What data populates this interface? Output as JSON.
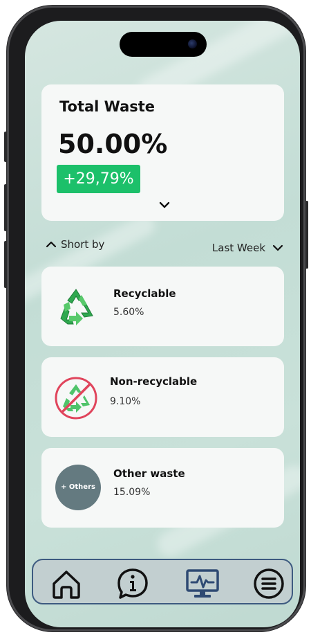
{
  "summary": {
    "title": "Total Waste",
    "value": "50.00%",
    "change": "+29,79%"
  },
  "filters": {
    "sort_label": "Short by",
    "period_label": "Last Week"
  },
  "categories": [
    {
      "name": "Recyclable",
      "percent": "5.60%",
      "icon": "recycle-icon"
    },
    {
      "name": "Non-recyclable",
      "percent": "9.10%",
      "icon": "no-recycle-icon"
    },
    {
      "name": "Other waste",
      "percent": "15.09%",
      "icon": "others-icon",
      "icon_text": "+ Others"
    }
  ],
  "nav": {
    "items": [
      {
        "icon": "home-icon"
      },
      {
        "icon": "info-icon"
      },
      {
        "icon": "monitor-icon",
        "active": true
      },
      {
        "icon": "menu-icon"
      }
    ]
  },
  "colors": {
    "accent_green": "#1cc06a",
    "nav_border": "#3d5a80",
    "active_icon": "#2e4a73",
    "others_circle": "#647a80",
    "no_sign_red": "#e0455c"
  }
}
